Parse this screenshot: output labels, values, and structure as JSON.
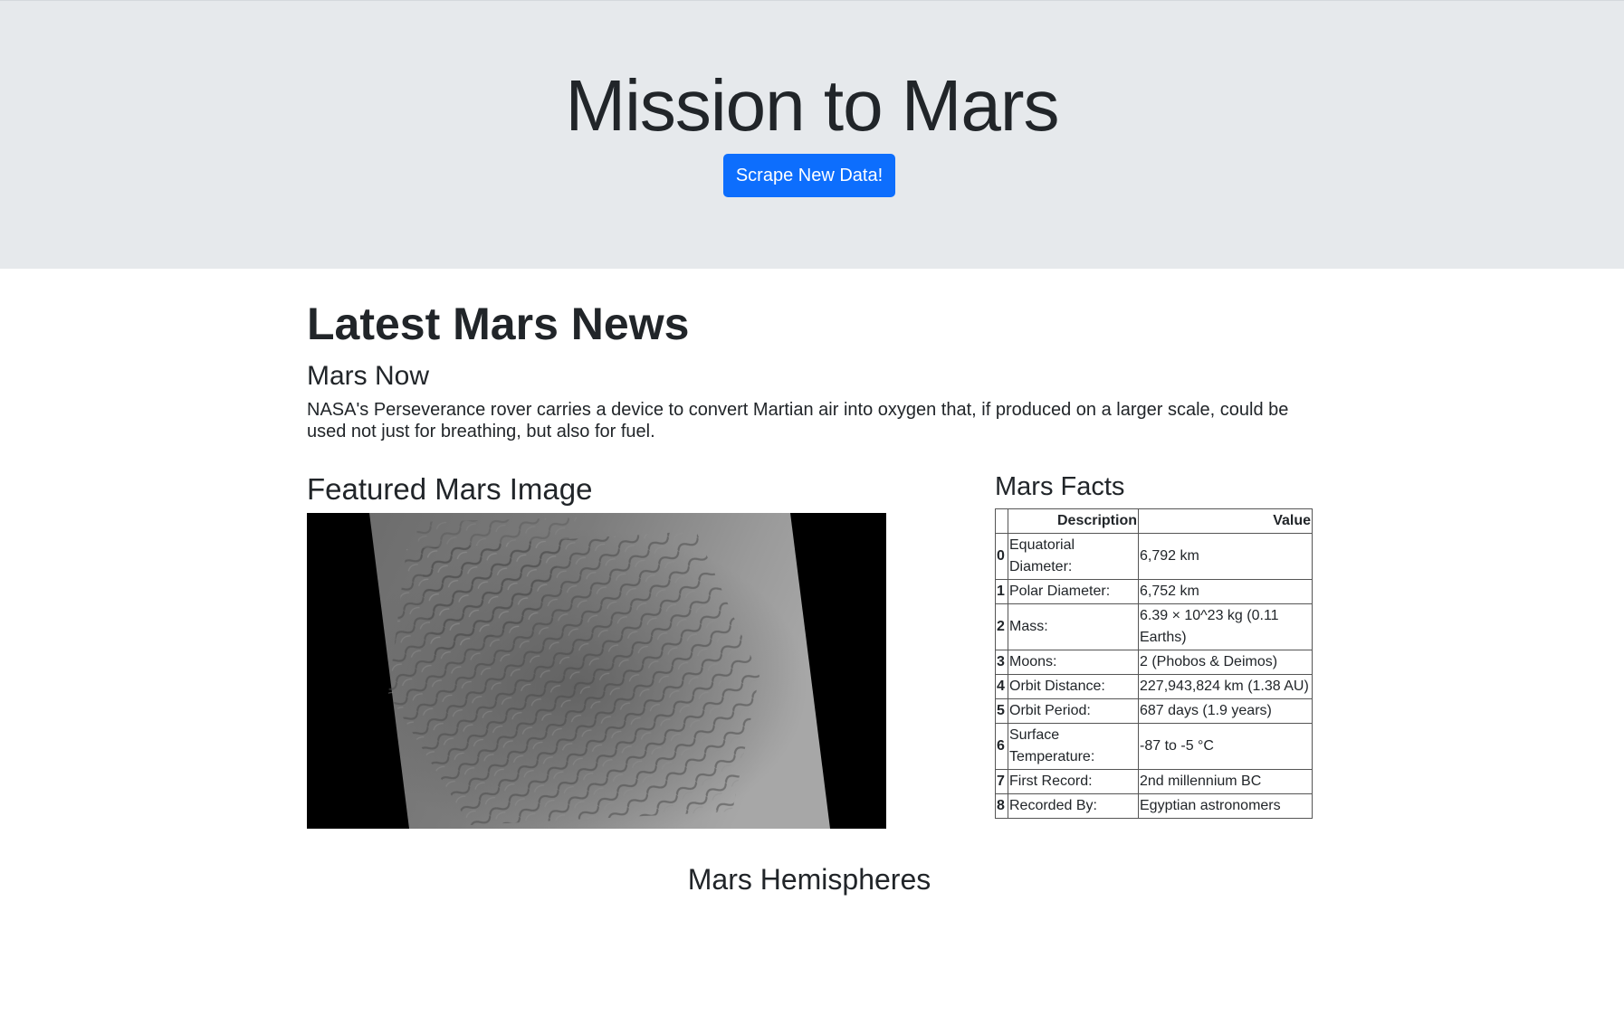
{
  "header": {
    "title": "Mission to Mars",
    "scrape_button": "Scrape New Data!"
  },
  "news": {
    "heading": "Latest Mars News",
    "title": "Mars Now",
    "paragraph": "NASA's Perseverance rover carries a device to convert Martian air into oxygen that, if produced on a larger scale, could be used not just for breathing, but also for fuel."
  },
  "featured": {
    "heading": "Featured Mars Image"
  },
  "facts": {
    "heading": "Mars Facts",
    "columns": [
      "",
      "Description",
      "Value"
    ],
    "rows": [
      {
        "index": "0",
        "description": "Equatorial Diameter:",
        "value": "6,792 km"
      },
      {
        "index": "1",
        "description": "Polar Diameter:",
        "value": "6,752 km"
      },
      {
        "index": "2",
        "description": "Mass:",
        "value": "6.39 × 10^23 kg (0.11 Earths)"
      },
      {
        "index": "3",
        "description": "Moons:",
        "value": "2 (Phobos & Deimos)"
      },
      {
        "index": "4",
        "description": "Orbit Distance:",
        "value": "227,943,824 km (1.38 AU)"
      },
      {
        "index": "5",
        "description": "Orbit Period:",
        "value": "687 days (1.9 years)"
      },
      {
        "index": "6",
        "description": "Surface Temperature:",
        "value": "-87 to -5 °C"
      },
      {
        "index": "7",
        "description": "First Record:",
        "value": "2nd millennium BC"
      },
      {
        "index": "8",
        "description": "Recorded By:",
        "value": "Egyptian astronomers"
      }
    ]
  },
  "hemispheres": {
    "heading": "Mars Hemispheres"
  }
}
